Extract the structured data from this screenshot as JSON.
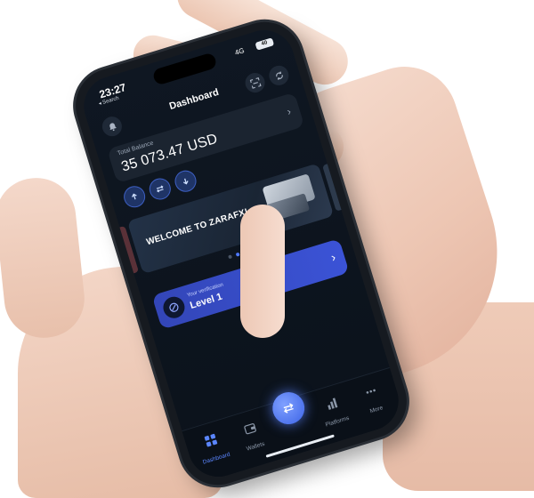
{
  "status_bar": {
    "time": "23:27",
    "back_label": "◂ Search",
    "network": "4G",
    "battery": "40"
  },
  "header": {
    "title": "Dashboard",
    "icons": [
      "bell-icon",
      "scan-icon",
      "sync-icon"
    ]
  },
  "balance": {
    "label": "Total Balance",
    "value": "35 073.47 USD"
  },
  "actions": [
    {
      "icon": "deposit-icon"
    },
    {
      "icon": "transfer-icon"
    },
    {
      "icon": "withdraw-icon"
    }
  ],
  "banner": {
    "title": "WELCOME TO ZARAFX!",
    "slide_count": 4,
    "active_slide": 2
  },
  "verification": {
    "label": "Your verification",
    "level": "Level 1"
  },
  "tab_bar": {
    "tabs": [
      {
        "label": "Dashboard",
        "icon": "grid-icon",
        "active": true
      },
      {
        "label": "Wallets",
        "icon": "wallet-icon",
        "active": false
      },
      {
        "label": "Platforms",
        "icon": "chart-icon",
        "active": false
      },
      {
        "label": "More",
        "icon": "more-icon",
        "active": false
      }
    ],
    "center_icon": "exchange-icon"
  },
  "colors": {
    "screen_bg": "#0f1722",
    "accent": "#4f79ff",
    "verify_card": "#3b53d6"
  }
}
